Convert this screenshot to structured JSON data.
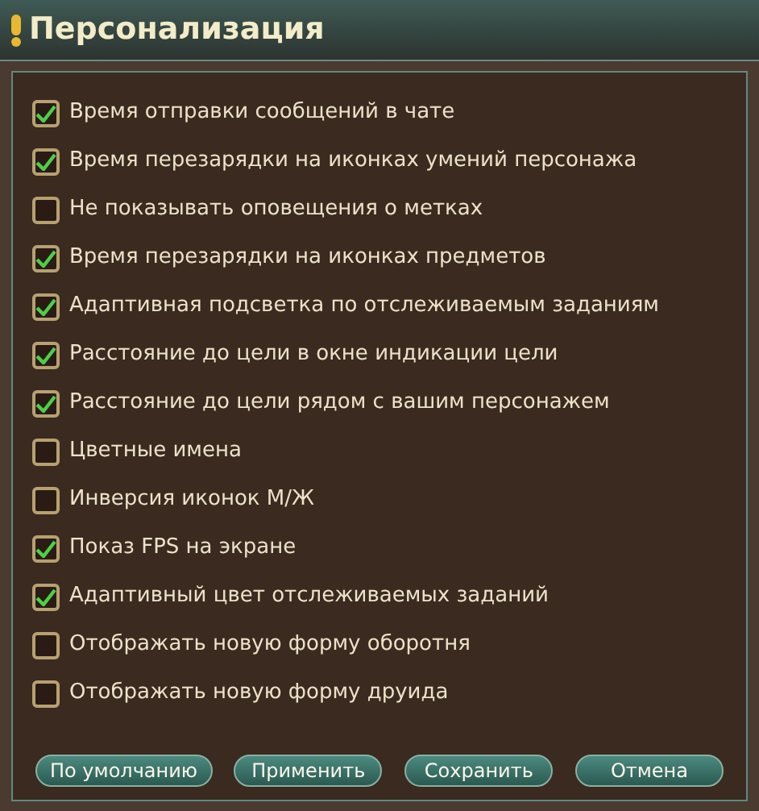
{
  "window": {
    "title": "Персонализация"
  },
  "options": [
    {
      "label": "Время отправки сообщений в чате",
      "checked": true
    },
    {
      "label": "Время перезарядки на иконках умений персонажа",
      "checked": true
    },
    {
      "label": "Не показывать оповещения о метках",
      "checked": false
    },
    {
      "label": "Время перезарядки на иконках предметов",
      "checked": true
    },
    {
      "label": "Адаптивная подсветка по отслеживаемым заданиям",
      "checked": true
    },
    {
      "label": "Расстояние до цели в окне индикации цели",
      "checked": true
    },
    {
      "label": "Расстояние до цели рядом с вашим персонажем",
      "checked": true
    },
    {
      "label": "Цветные имена",
      "checked": false
    },
    {
      "label": "Инверсия иконок М/Ж",
      "checked": false
    },
    {
      "label": "Показ FPS на экране",
      "checked": true
    },
    {
      "label": "Адаптивный цвет отслеживаемых заданий",
      "checked": true
    },
    {
      "label": "Отображать новую форму оборотня",
      "checked": false
    },
    {
      "label": "Отображать новую форму друида",
      "checked": false
    }
  ],
  "buttons": [
    "По умолчанию",
    "Применить",
    "Сохранить",
    "Отмена"
  ]
}
